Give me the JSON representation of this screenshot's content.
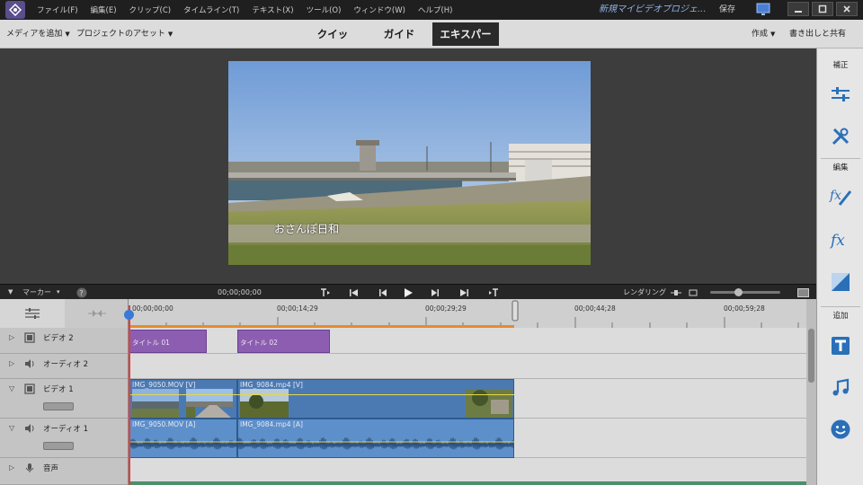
{
  "menubar": {
    "items": [
      "ファイル(F)",
      "編集(E)",
      "クリップ(C)",
      "タイムライン(T)",
      "テキスト(X)",
      "ツール(O)",
      "ウィンドウ(W)",
      "ヘルプ(H)"
    ],
    "project_title": "新規マイビデオプロジェ...",
    "save_label": "保存"
  },
  "modebar": {
    "add_media": "メディアを追加",
    "project_assets": "プロジェクトのアセット",
    "tabs": [
      "クイック",
      "ガイド",
      "エキスパート"
    ],
    "active_tab": "エキスパート",
    "create": "作成",
    "export_share": "書き出しと共有"
  },
  "preview": {
    "caption": "おさんぽ日和"
  },
  "right_panel": {
    "adjust_label": "補正",
    "edit_label": "編集",
    "add_label": "追加"
  },
  "transport": {
    "marker_label": "マーカー",
    "timecode": "00;00;00;00",
    "render_label": "レンダリング"
  },
  "ruler": {
    "ticks": [
      "00;00;00;00",
      "00;00;14;29",
      "00;00;29;29",
      "00;00;44;28",
      "00;00;59;28"
    ]
  },
  "tracks": [
    {
      "name": "ビデオ 2",
      "type": "video"
    },
    {
      "name": "オーディオ 2",
      "type": "audio"
    },
    {
      "name": "ビデオ 1",
      "type": "video"
    },
    {
      "name": "オーディオ 1",
      "type": "audio"
    },
    {
      "name": "音声",
      "type": "voice"
    }
  ],
  "clips": {
    "title1": "タイトル 01",
    "title2": "タイトル 02",
    "video1": "IMG_9050.MOV [V]",
    "video2": "IMG_9084.mp4 [V]",
    "audio1": "IMG_9050.MOV [A]",
    "audio2": "IMG_9084.mp4 [A]"
  },
  "colors": {
    "title_clip": "#8c5db1",
    "video_clip": "#4b7ab3",
    "audio_clip": "#5d8fcb",
    "playhead": "#e04040"
  }
}
